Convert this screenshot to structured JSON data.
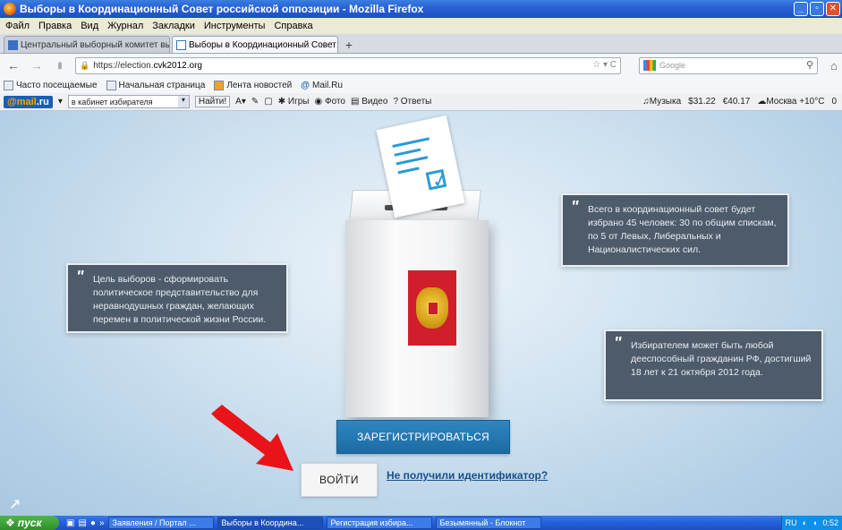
{
  "window": {
    "title": "Выборы в Координационный Совет российской оппозиции - Mozilla Firefox"
  },
  "menu": [
    "Файл",
    "Правка",
    "Вид",
    "Журнал",
    "Закладки",
    "Инструменты",
    "Справка"
  ],
  "tabs": [
    {
      "label": "Центральный выборный комитет выб...",
      "active": false
    },
    {
      "label": "Выборы в Координационный Совет ро...",
      "active": true
    }
  ],
  "nav": {
    "url_prefix": "https://election.",
    "url_domain": "cvk2012.org",
    "search_placeholder": "Google"
  },
  "bookmarks": [
    "Часто посещаемые",
    "Начальная страница",
    "Лента новостей",
    "Mail.Ru"
  ],
  "mailbar": {
    "logo_prefix": "@mail",
    "logo_suffix": ".ru",
    "cabinet_text": "в кабинет избирателя",
    "find_label": "Найти!",
    "links": [
      "Игры",
      "Фото",
      "Видео",
      "Ответы"
    ],
    "music": "Музыка",
    "usd": "$31.22",
    "eur": "€40.17",
    "weather": "Москва +10°C",
    "count": "0"
  },
  "page": {
    "card_goal": "Цель выборов - сформировать политическое представительство для неравнодушных граждан, желающих перемен в политической жизни России.",
    "card_council": "Всего в координационный совет будет избрано 45 человек: 30 по общим спискам, по 5 от Левых, Либеральных и Националистических сил.",
    "card_voter": "Избирателем может быть любой дееспособный гражданин РФ, достигший 18 лет к 21 октября 2012 года.",
    "register_label": "ЗАРЕГИСТРИРОВАТЬСЯ",
    "login_label": "ВОЙТИ",
    "no_id_link": "Не получили идентификатор?"
  },
  "taskbar": {
    "start_label": "пуск",
    "tasks": [
      {
        "label": "Заявления / Портал ...",
        "active": false
      },
      {
        "label": "Выборы в Координа...",
        "active": true
      },
      {
        "label": "Регистрация избира...",
        "active": false
      },
      {
        "label": "Безымянный - Блокнот",
        "active": false
      }
    ],
    "lang": "RU",
    "clock": "0:52"
  },
  "colors": {
    "accent_blue": "#1f70a8",
    "arrow_red": "#e8141a",
    "card_bg": "#4d5b6b"
  }
}
